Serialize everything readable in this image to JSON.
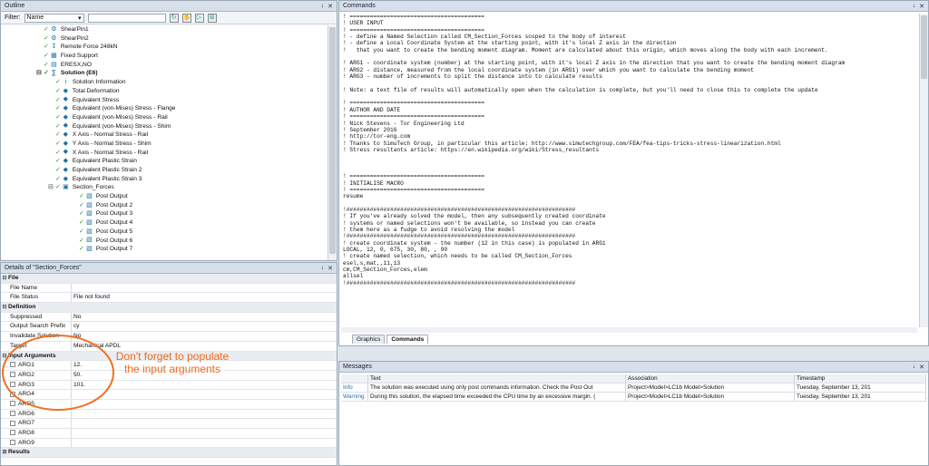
{
  "outline": {
    "title": "Outline",
    "pin": "↓",
    "close": "✕",
    "filter_label": "Filter:",
    "filter_value": "Name",
    "filter_arrow": "▾",
    "toolbar_icons": [
      "↻",
      "✋",
      "▷",
      "⊞"
    ],
    "items": [
      {
        "label": "ShearPin1",
        "indent": 3,
        "icon": "pin-icon",
        "glyph": "⚙",
        "bold": false
      },
      {
        "label": "ShearPin2",
        "indent": 3,
        "icon": "pin-icon",
        "glyph": "⚙",
        "bold": false
      },
      {
        "label": "Remote Force 248kN",
        "indent": 3,
        "icon": "force-icon",
        "glyph": "↧",
        "bold": false
      },
      {
        "label": "Fixed Support",
        "indent": 3,
        "icon": "support-icon",
        "glyph": "▦",
        "bold": false
      },
      {
        "label": "ERESX,NO",
        "indent": 3,
        "icon": "command-icon",
        "glyph": "▤",
        "bold": false
      },
      {
        "label": "Solution (E6)",
        "indent": 3,
        "icon": "solution-icon",
        "glyph": "∑",
        "bold": true,
        "expander": "⊟"
      },
      {
        "label": "Solution Information",
        "indent": 4,
        "icon": "info-icon",
        "glyph": "i",
        "bold": false
      },
      {
        "label": "Total Deformation",
        "indent": 4,
        "icon": "result-icon",
        "glyph": "◆",
        "bold": false
      },
      {
        "label": "Equivalent Stress",
        "indent": 4,
        "icon": "result-icon",
        "glyph": "◆",
        "bold": false
      },
      {
        "label": "Equivalent (von-Mises) Stress - Flange",
        "indent": 4,
        "icon": "result-icon",
        "glyph": "◆",
        "bold": false
      },
      {
        "label": "Equivalent (von-Mises) Stress - Rail",
        "indent": 4,
        "icon": "result-icon",
        "glyph": "◆",
        "bold": false
      },
      {
        "label": "Equivalent (von-Mises) Stress - Shim",
        "indent": 4,
        "icon": "result-icon",
        "glyph": "◆",
        "bold": false
      },
      {
        "label": "X Axis - Normal Stress - Rail",
        "indent": 4,
        "icon": "result-icon",
        "glyph": "◆",
        "bold": false
      },
      {
        "label": "Y Axis - Normal Stress - Shim",
        "indent": 4,
        "icon": "result-icon",
        "glyph": "◆",
        "bold": false
      },
      {
        "label": "X Axis - Normal Stress - Rail",
        "indent": 4,
        "icon": "result-icon",
        "glyph": "◆",
        "bold": false
      },
      {
        "label": "Equivalent Plastic Strain",
        "indent": 4,
        "icon": "result-icon",
        "glyph": "◆",
        "bold": false
      },
      {
        "label": "Equivalent Plastic Strain 2",
        "indent": 4,
        "icon": "result-icon",
        "glyph": "◆",
        "bold": false
      },
      {
        "label": "Equivalent Plastic Strain 3",
        "indent": 4,
        "icon": "result-icon",
        "glyph": "◆",
        "bold": false
      },
      {
        "label": "Section_Forces",
        "indent": 4,
        "icon": "macro-icon",
        "glyph": "▣",
        "bold": false,
        "expander": "⊟"
      },
      {
        "label": "Post Output",
        "indent": 6,
        "icon": "post-output-icon",
        "glyph": "▧",
        "bold": false
      },
      {
        "label": "Post Output 2",
        "indent": 6,
        "icon": "post-output-icon",
        "glyph": "▧",
        "bold": false
      },
      {
        "label": "Post Output 3",
        "indent": 6,
        "icon": "post-output-icon",
        "glyph": "▧",
        "bold": false
      },
      {
        "label": "Post Output 4",
        "indent": 6,
        "icon": "post-output-icon",
        "glyph": "▧",
        "bold": false
      },
      {
        "label": "Post Output 5",
        "indent": 6,
        "icon": "post-output-icon",
        "glyph": "▧",
        "bold": false
      },
      {
        "label": "Post Output 6",
        "indent": 6,
        "icon": "post-output-icon",
        "glyph": "▧",
        "bold": false
      },
      {
        "label": "Post Output 7",
        "indent": 6,
        "icon": "post-output-icon",
        "glyph": "▧",
        "bold": false
      }
    ]
  },
  "details": {
    "title": "Details of \"Section_Forces\"",
    "pin": "↓",
    "close": "✕",
    "rows": [
      {
        "section": true,
        "key": "File",
        "toggle": "⊟"
      },
      {
        "key": "File Name",
        "value": ""
      },
      {
        "key": "File Status",
        "value": "File not found"
      },
      {
        "section": true,
        "key": "Definition",
        "toggle": "⊟"
      },
      {
        "key": "Suppressed",
        "value": "No"
      },
      {
        "key": "Output Search Prefix",
        "value": "cy"
      },
      {
        "key": "Invalidate Solution",
        "value": "No"
      },
      {
        "key": "Target",
        "value": "Mechanical APDL"
      },
      {
        "section": true,
        "key": "Input Arguments",
        "toggle": "⊟"
      },
      {
        "key": "ARG1",
        "value": "12.",
        "checkbox": true
      },
      {
        "key": "ARG2",
        "value": "50.",
        "checkbox": true
      },
      {
        "key": "ARG3",
        "value": "101.",
        "checkbox": true
      },
      {
        "key": "ARG4",
        "value": "",
        "checkbox": true
      },
      {
        "key": "ARG5",
        "value": "",
        "checkbox": true
      },
      {
        "key": "ARG6",
        "value": "",
        "checkbox": true
      },
      {
        "key": "ARG7",
        "value": "",
        "checkbox": true
      },
      {
        "key": "ARG8",
        "value": "",
        "checkbox": true
      },
      {
        "key": "ARG9",
        "value": "",
        "checkbox": true
      },
      {
        "section": true,
        "key": "Results",
        "toggle": "⊞"
      }
    ],
    "annotation": "Don't forget to populate the input arguments"
  },
  "commands": {
    "title": "Commands",
    "pin": "↓",
    "close": "✕",
    "tabs": [
      "Graphics",
      "Commands"
    ],
    "active_tab": "Commands",
    "lines": [
      "! ========================================",
      "! USER INPUT",
      "! ========================================",
      "! - define a Named Selection called CM_Section_Forces scoped to the body of interest",
      "! - define a Local Coordinate System at the starting point, with it's local Z axis in the direction",
      "!   that you want to create the bending moment diagram. Moment are calculated about this origin, which moves along the body with each increment.",
      "",
      "! ARG1 - coordinate system (number) at the starting point, with it's local Z axis in the direction that you want to create the bending moment diagram",
      "! ARG2 - distance, measured from the local coordinate system (in ARG1) over which you want to calculate the bending moment",
      "! ARG3 - number of increments to split the distance into to calculate results",
      "",
      "! Note: a text file of results will automatically open when the calculation is complete, but you'll need to close this to complete the update",
      "",
      "! ========================================",
      "! AUTHOR AND DATE",
      "! ========================================",
      "! Nick Stevens - Tor Engineering Ltd",
      "! September 2016",
      "! http://tor-eng.com",
      "! Thanks to SimuTech Group, in particular this article: http://www.simutechgroup.com/FEA/fea-tips-tricks-stress-linearization.html",
      "! Stress resultants article: https://en.wikipedia.org/wiki/Stress_resultants",
      "",
      "",
      "",
      "! ========================================",
      "! INITIALISE MACRO",
      "! ========================================",
      "resume",
      "",
      "!####################################################################",
      "! If you've already solved the model, then any subsequently created coordinate",
      "! systems or named selections won't be available, so instead you can create",
      "! them here as a fudge to avoid resolving the model",
      "!####################################################################",
      "! create coordinate system - the number (12 in this case) is populated in ARG1",
      "LOCAL, 12, 0, 675, 30, 80, , 90",
      "! create named selection, which needs to be called CM_Section_Forces",
      "esel,s,mat,,11,13",
      "cm,CM_Section_Forces,elem",
      "allsel",
      "!####################################################################"
    ]
  },
  "messages": {
    "title": "Messages",
    "pin": "↓",
    "close": "✕",
    "headers": [
      "",
      "Text",
      "Association",
      "Timestamp"
    ],
    "rows": [
      {
        "type": "Info",
        "text": "The solution was executed using only post commands information. Check the Post Out",
        "association": "Project>Model>LC1b Model>Solution",
        "timestamp": "Tuesday, September 13, 201"
      },
      {
        "type": "Warning",
        "text": "During this solution, the elapsed time exceeded the CPU time by an excessive margin. (",
        "association": "Project>Model>LC1b Model>Solution",
        "timestamp": "Tuesday, September 13, 201"
      }
    ]
  },
  "colors": {
    "accent_orange": "#f26a1b",
    "check_green": "#2a9a2a",
    "icon_blue": "#1a6ea8"
  }
}
